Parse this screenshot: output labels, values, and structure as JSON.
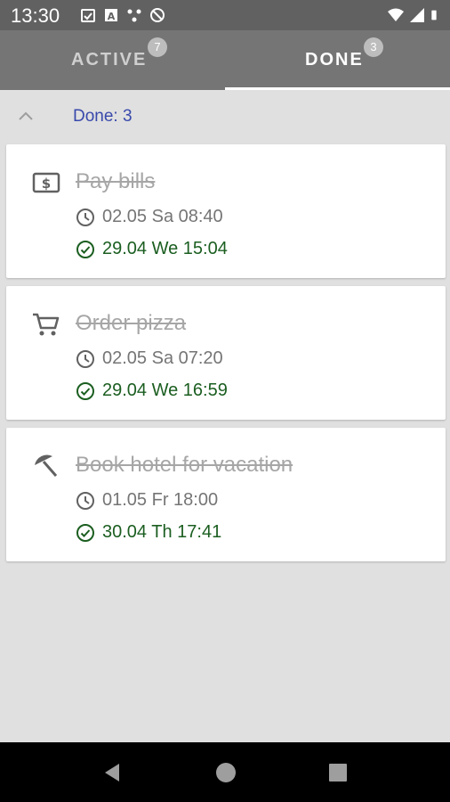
{
  "status_bar": {
    "time": "13:30"
  },
  "tabs": [
    {
      "label": "ACTIVE",
      "badge": "7"
    },
    {
      "label": "DONE",
      "badge": "3"
    }
  ],
  "section": {
    "title": "Done: 3"
  },
  "tasks": [
    {
      "title": "Pay bills",
      "icon": "dollar-bill-icon",
      "due": "02.05 Sa 08:40",
      "done": "29.04 We 15:04"
    },
    {
      "title": "Order pizza",
      "icon": "shopping-cart-icon",
      "due": "02.05 Sa 07:20",
      "done": "29.04 We 16:59"
    },
    {
      "title": "Book hotel for vacation",
      "icon": "beach-umbrella-icon",
      "due": "01.05 Fr 18:00",
      "done": "30.04 Th 17:41"
    }
  ],
  "colors": {
    "toolbar": "#757575",
    "status": "#616161",
    "accent_text": "#3949ab",
    "done_green": "#1b5e20"
  }
}
